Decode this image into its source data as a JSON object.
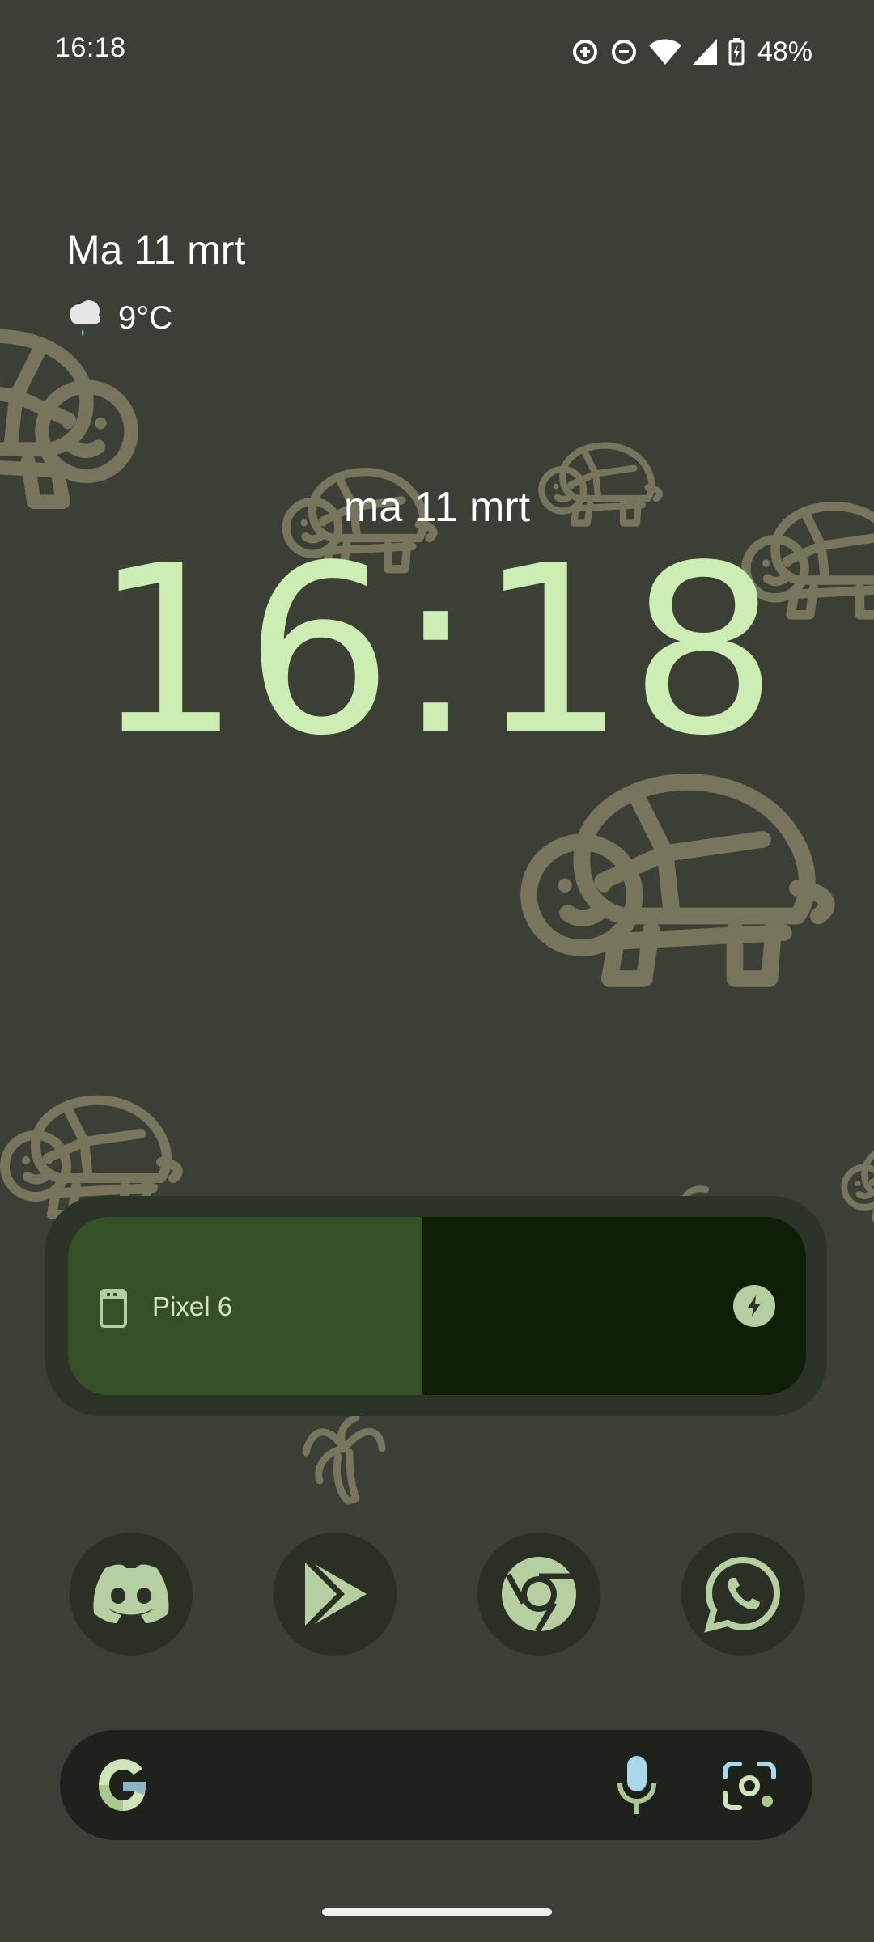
{
  "status_bar": {
    "time": "16:18",
    "icons": [
      "data-saver-icon",
      "do-not-disturb-icon",
      "wifi-icon",
      "cell-signal-icon",
      "battery-charging-icon"
    ],
    "battery_percent": "48%"
  },
  "glance": {
    "date": "Ma 11 mrt",
    "weather_icon": "cloud-rain-icon",
    "temperature": "9°C"
  },
  "clock": {
    "date": "ma 11 mrt",
    "time": "16:18",
    "color": "#cdeeb3"
  },
  "battery_widget": {
    "device_name": "Pixel 6",
    "level": 0.48,
    "charging": true,
    "fill_color": "#355026",
    "empty_color": "#0d1f07"
  },
  "dock": {
    "apps": [
      {
        "name": "Discord",
        "icon": "discord-icon"
      },
      {
        "name": "Play Store",
        "icon": "play-store-icon"
      },
      {
        "name": "Chrome",
        "icon": "chrome-icon"
      },
      {
        "name": "WhatsApp",
        "icon": "whatsapp-icon"
      }
    ],
    "icon_color": "#b6cfa1"
  },
  "search_bar": {
    "logo": "google-icon",
    "mic": "mic-icon",
    "lens": "lens-icon"
  },
  "colors": {
    "wallpaper": "#3b3f36",
    "turtle_outline": "#77765c"
  }
}
